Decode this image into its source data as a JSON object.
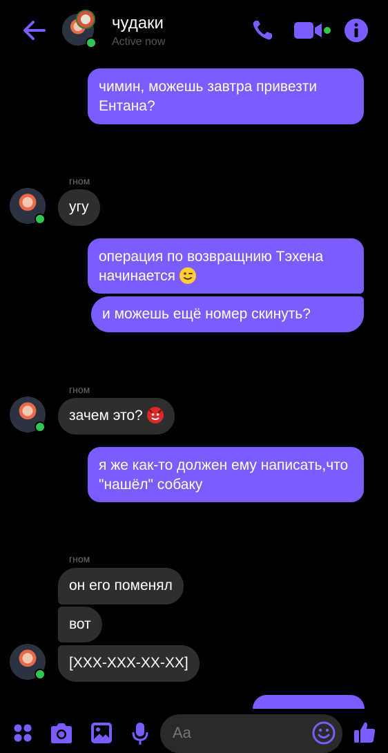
{
  "header": {
    "title": "чудаки",
    "status": "Active now"
  },
  "messages": [
    {
      "dir": "out",
      "text": "чимин, можешь завтра привезти Ентана?"
    },
    {
      "dir": "in",
      "sender": "гном",
      "text": "угу"
    },
    {
      "dir": "out",
      "text": "операция по возвращнию Тэхена начинается",
      "emoji": "winking-face"
    },
    {
      "dir": "out",
      "text": "и можешь ещё номер скинуть?"
    },
    {
      "dir": "in",
      "sender": "гном",
      "text": "зачем это?",
      "emoji": "devil-face"
    },
    {
      "dir": "out",
      "text": "я же как-то должен ему написать,что \"нашёл\" собаку"
    },
    {
      "dir": "in",
      "sender": "гном",
      "text": "он его поменял"
    },
    {
      "dir": "in",
      "text": "вот"
    },
    {
      "dir": "in",
      "text": "[XXX-XXX-XX-XX]"
    }
  ],
  "composer": {
    "placeholder": "Aa"
  },
  "colors": {
    "accent": "#7b5cff",
    "incoming_bubble": "#2e2e2e",
    "online": "#31c552",
    "background": "#000000"
  },
  "icons": [
    "back-arrow-icon",
    "phone-icon",
    "video-camera-icon",
    "info-icon",
    "apps-icon",
    "camera-icon",
    "image-icon",
    "microphone-icon",
    "emoji-icon",
    "thumbs-up-icon"
  ]
}
